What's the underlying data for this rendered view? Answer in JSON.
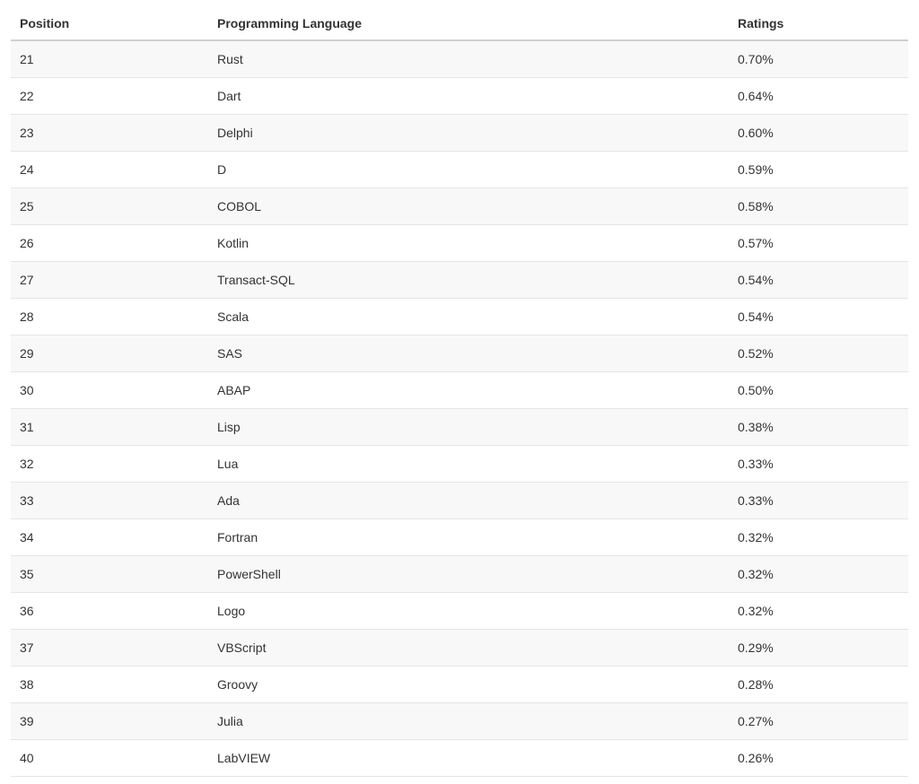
{
  "table": {
    "headers": {
      "position": "Position",
      "language": "Programming Language",
      "ratings": "Ratings"
    },
    "rows": [
      {
        "position": "21",
        "language": "Rust",
        "ratings": "0.70%"
      },
      {
        "position": "22",
        "language": "Dart",
        "ratings": "0.64%"
      },
      {
        "position": "23",
        "language": "Delphi",
        "ratings": "0.60%"
      },
      {
        "position": "24",
        "language": "D",
        "ratings": "0.59%"
      },
      {
        "position": "25",
        "language": "COBOL",
        "ratings": "0.58%"
      },
      {
        "position": "26",
        "language": "Kotlin",
        "ratings": "0.57%"
      },
      {
        "position": "27",
        "language": "Transact-SQL",
        "ratings": "0.54%"
      },
      {
        "position": "28",
        "language": "Scala",
        "ratings": "0.54%"
      },
      {
        "position": "29",
        "language": "SAS",
        "ratings": "0.52%"
      },
      {
        "position": "30",
        "language": "ABAP",
        "ratings": "0.50%"
      },
      {
        "position": "31",
        "language": "Lisp",
        "ratings": "0.38%"
      },
      {
        "position": "32",
        "language": "Lua",
        "ratings": "0.33%"
      },
      {
        "position": "33",
        "language": "Ada",
        "ratings": "0.33%"
      },
      {
        "position": "34",
        "language": "Fortran",
        "ratings": "0.32%"
      },
      {
        "position": "35",
        "language": "PowerShell",
        "ratings": "0.32%"
      },
      {
        "position": "36",
        "language": "Logo",
        "ratings": "0.32%"
      },
      {
        "position": "37",
        "language": "VBScript",
        "ratings": "0.29%"
      },
      {
        "position": "38",
        "language": "Groovy",
        "ratings": "0.28%"
      },
      {
        "position": "39",
        "language": "Julia",
        "ratings": "0.27%"
      },
      {
        "position": "40",
        "language": "LabVIEW",
        "ratings": "0.26%"
      }
    ]
  }
}
